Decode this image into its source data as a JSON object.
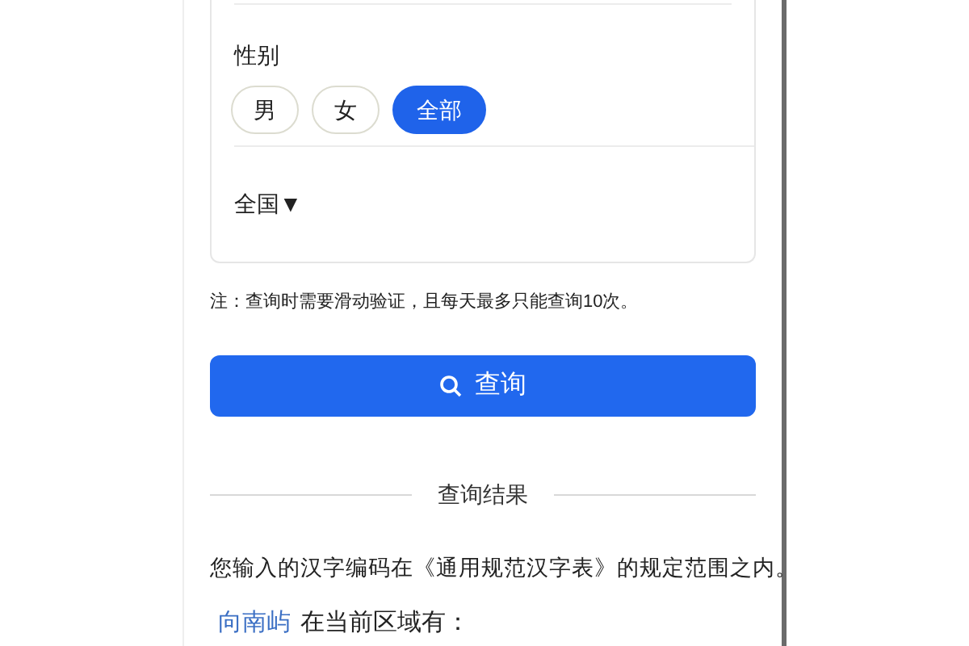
{
  "gender": {
    "label": "性别",
    "options": [
      {
        "label": "男",
        "selected": false
      },
      {
        "label": "女",
        "selected": false
      },
      {
        "label": "全部",
        "selected": true
      }
    ]
  },
  "region": {
    "value": "全国",
    "caret": "▼"
  },
  "note": "注：查询时需要滑动验证，且每天最多只能查询10次。",
  "search_button": {
    "label": "查询"
  },
  "results": {
    "heading": "查询结果",
    "message": "您输入的汉字编码在《通用规范汉字表》的规定范围之内。",
    "name": "向南屿",
    "suffix": "在当前区域有："
  }
}
